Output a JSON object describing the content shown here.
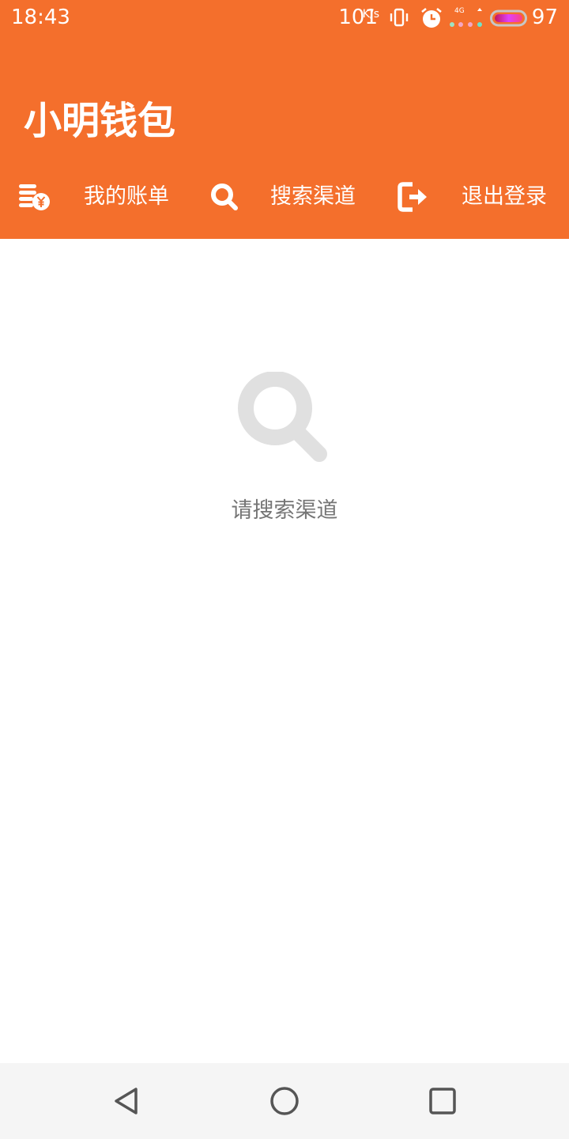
{
  "status_bar": {
    "time": "18:43",
    "net_speed": "101",
    "net_speed_unit": "K/s",
    "network_type": "4G",
    "battery_level": "97",
    "icons": [
      "vibrate-icon",
      "alarm-icon",
      "signal-icon",
      "battery-icon"
    ]
  },
  "header": {
    "title": "小明钱包",
    "background_color": "#f46f2c",
    "nav": [
      {
        "label": "我的账单",
        "icon": "bill-coins-icon"
      },
      {
        "label": "搜索渠道",
        "icon": "search-icon"
      },
      {
        "label": "退出登录",
        "icon": "logout-icon"
      }
    ]
  },
  "empty_state": {
    "icon": "search-icon",
    "message": "请搜索渠道"
  },
  "system_nav": {
    "buttons": [
      "back-icon",
      "home-icon",
      "recents-icon"
    ]
  }
}
